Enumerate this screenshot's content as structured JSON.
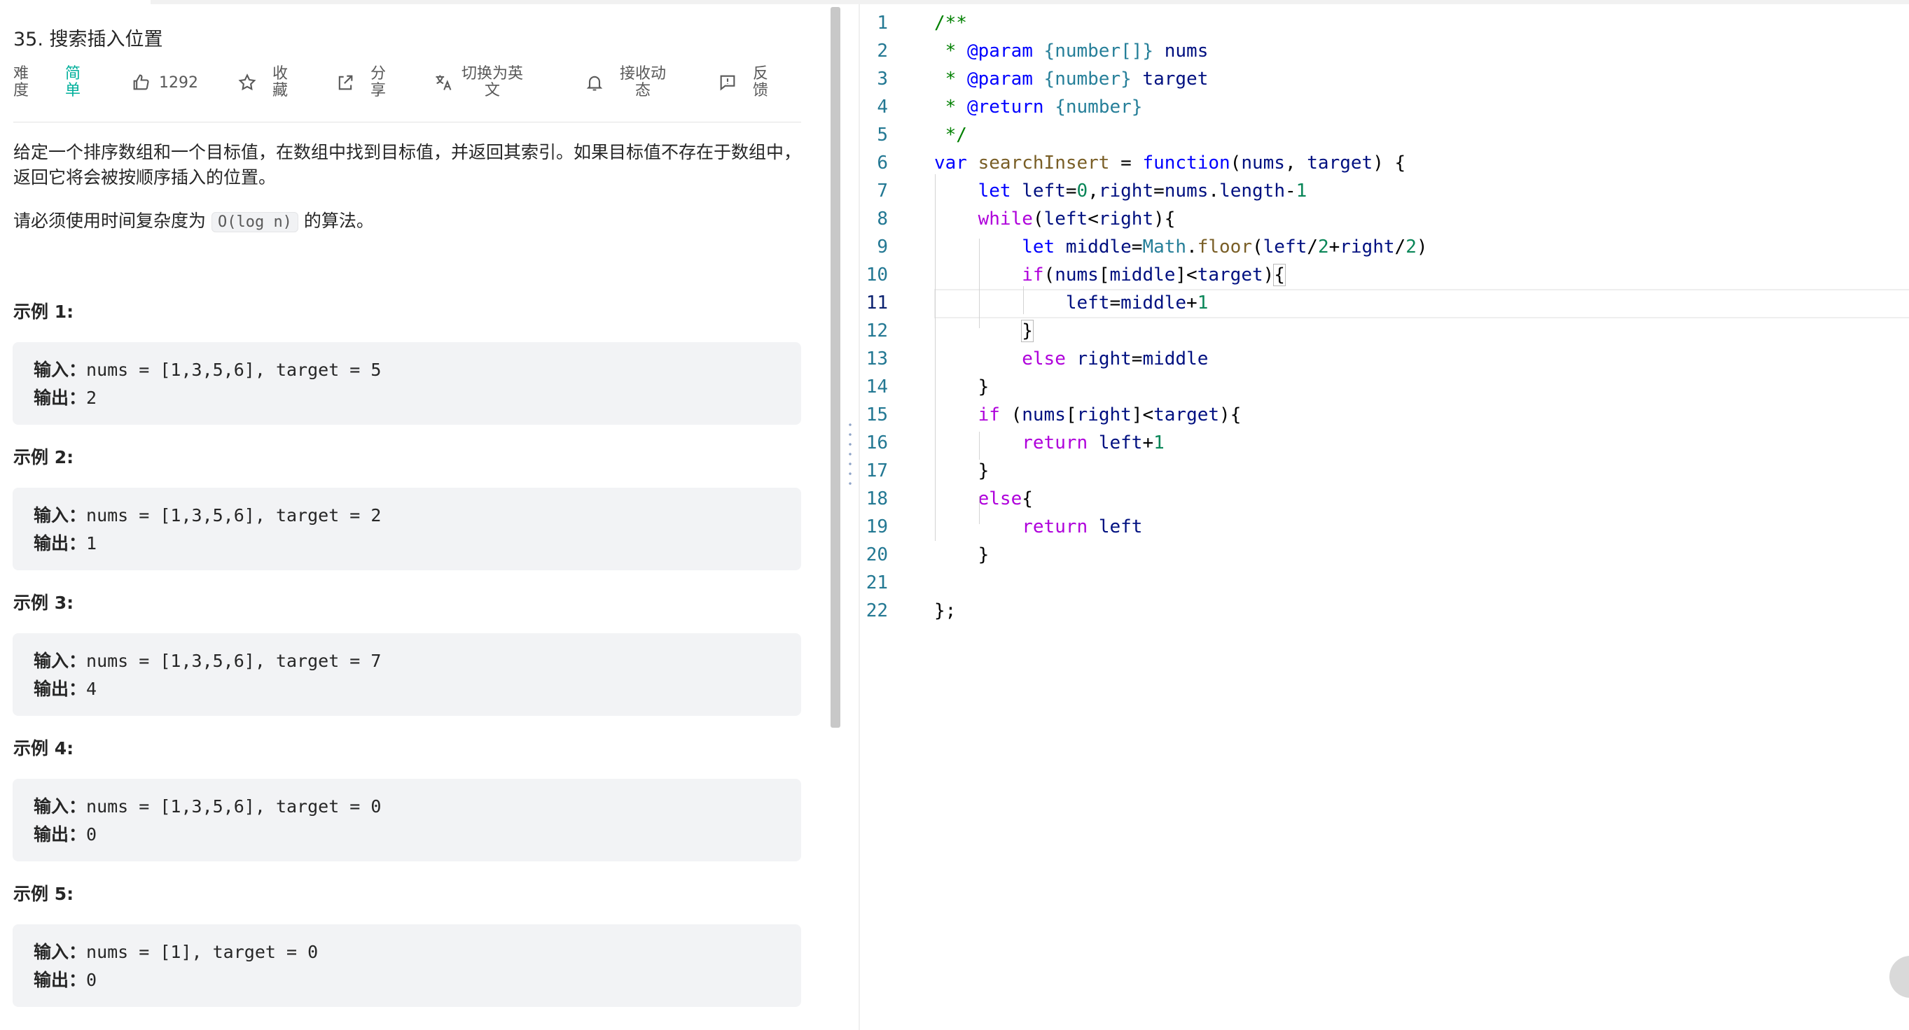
{
  "problem": {
    "title": "35. 搜索插入位置",
    "difficulty_label_top": "难",
    "difficulty_label_bottom": "度",
    "difficulty_value_top": "简",
    "difficulty_value_bottom": "单",
    "likes": "1292",
    "collect_top": "收",
    "collect_bottom": "藏",
    "share_top": "分",
    "share_bottom": "享",
    "translate_top": "切换为英",
    "translate_bottom": "文",
    "subscribe_top": "接收动",
    "subscribe_bottom": "态",
    "feedback_top": "反",
    "feedback_bottom": "馈",
    "description_1": "给定一个排序数组和一个目标值，在数组中找到目标值，并返回其索引。如果目标值不存在于数组中，返回它将会被按顺序插入的位置。",
    "description_2_before": "请必须使用时间复杂度为",
    "description_2_code": "O(log n)",
    "description_2_after": "的算法。",
    "colors": {
      "easy": "#00af9b",
      "accent_gutter": "#237893"
    }
  },
  "examples": [
    {
      "title": "示例 1:",
      "input_label": "输入：",
      "input": "nums = [1,3,5,6], target = 5",
      "output_label": "输出：",
      "output": "2"
    },
    {
      "title": "示例 2:",
      "input_label": "输入：",
      "input": "nums = [1,3,5,6], target = 2",
      "output_label": "输出：",
      "output": "1"
    },
    {
      "title": "示例 3:",
      "input_label": "输入：",
      "input": "nums = [1,3,5,6], target = 7",
      "output_label": "输出：",
      "output": "4"
    },
    {
      "title": "示例 4:",
      "input_label": "输入：",
      "input": "nums = [1,3,5,6], target = 0",
      "output_label": "输出：",
      "output": "0"
    },
    {
      "title": "示例 5:",
      "input_label": "输入：",
      "input": "nums = [1], target = 0",
      "output_label": "输出：",
      "output": "0"
    }
  ],
  "editor": {
    "active_line": 11,
    "line_numbers": [
      "1",
      "2",
      "3",
      "4",
      "5",
      "6",
      "7",
      "8",
      "9",
      "10",
      "11",
      "12",
      "13",
      "14",
      "15",
      "16",
      "17",
      "18",
      "19",
      "20",
      "21",
      "22"
    ],
    "lines": [
      [
        [
          "cm",
          "/**"
        ]
      ],
      [
        [
          "cm",
          " * "
        ],
        [
          "kc2",
          "@param"
        ],
        [
          "ty",
          " {number[]}"
        ],
        [
          "id",
          " nums"
        ]
      ],
      [
        [
          "cm",
          " * "
        ],
        [
          "kc2",
          "@param"
        ],
        [
          "ty",
          " {number}"
        ],
        [
          "id",
          " target"
        ]
      ],
      [
        [
          "cm",
          " * "
        ],
        [
          "kc2",
          "@return"
        ],
        [
          "ty",
          " {number}"
        ]
      ],
      [
        [
          "cm",
          " */"
        ]
      ],
      [
        [
          "k",
          "var"
        ],
        [
          "op",
          " "
        ],
        [
          "fn",
          "searchInsert"
        ],
        [
          "op",
          " = "
        ],
        [
          "k",
          "function"
        ],
        [
          "op",
          "("
        ],
        [
          "id",
          "nums"
        ],
        [
          "op",
          ", "
        ],
        [
          "id",
          "target"
        ],
        [
          "op",
          ") {"
        ]
      ],
      [
        [
          "op",
          "    "
        ],
        [
          "k",
          "let"
        ],
        [
          "op",
          " "
        ],
        [
          "id",
          "left"
        ],
        [
          "op",
          "="
        ],
        [
          "nm",
          "0"
        ],
        [
          "op",
          ","
        ],
        [
          "id",
          "right"
        ],
        [
          "op",
          "="
        ],
        [
          "id",
          "nums"
        ],
        [
          "op",
          "."
        ],
        [
          "id",
          "length"
        ],
        [
          "op",
          "-"
        ],
        [
          "nm",
          "1"
        ]
      ],
      [
        [
          "op",
          "    "
        ],
        [
          "kc",
          "while"
        ],
        [
          "op",
          "("
        ],
        [
          "id",
          "left"
        ],
        [
          "op",
          "<"
        ],
        [
          "id",
          "right"
        ],
        [
          "op",
          "){"
        ]
      ],
      [
        [
          "op",
          "        "
        ],
        [
          "k",
          "let"
        ],
        [
          "op",
          " "
        ],
        [
          "id",
          "middle"
        ],
        [
          "op",
          "="
        ],
        [
          "ty",
          "Math"
        ],
        [
          "op",
          "."
        ],
        [
          "fn",
          "floor"
        ],
        [
          "op",
          "("
        ],
        [
          "id",
          "left"
        ],
        [
          "op",
          "/"
        ],
        [
          "nm",
          "2"
        ],
        [
          "op",
          "+"
        ],
        [
          "id",
          "right"
        ],
        [
          "op",
          "/"
        ],
        [
          "nm",
          "2"
        ],
        [
          "op",
          ")"
        ]
      ],
      [
        [
          "op",
          "        "
        ],
        [
          "kc",
          "if"
        ],
        [
          "op",
          "("
        ],
        [
          "id",
          "nums"
        ],
        [
          "op",
          "["
        ],
        [
          "id",
          "middle"
        ],
        [
          "op",
          "]<"
        ],
        [
          "id",
          "target"
        ],
        [
          "op",
          ")"
        ],
        [
          "bm",
          "{"
        ]
      ],
      [
        [
          "op",
          "            "
        ],
        [
          "id",
          "left"
        ],
        [
          "op",
          "="
        ],
        [
          "id",
          "middle"
        ],
        [
          "op",
          "+"
        ],
        [
          "nm",
          "1"
        ]
      ],
      [
        [
          "op",
          "        "
        ],
        [
          "bm",
          "}"
        ]
      ],
      [
        [
          "op",
          "        "
        ],
        [
          "kc",
          "else"
        ],
        [
          "op",
          " "
        ],
        [
          "id",
          "right"
        ],
        [
          "op",
          "="
        ],
        [
          "id",
          "middle"
        ]
      ],
      [
        [
          "op",
          "    }"
        ]
      ],
      [
        [
          "op",
          "    "
        ],
        [
          "kc",
          "if"
        ],
        [
          "op",
          " ("
        ],
        [
          "id",
          "nums"
        ],
        [
          "op",
          "["
        ],
        [
          "id",
          "right"
        ],
        [
          "op",
          "]<"
        ],
        [
          "id",
          "target"
        ],
        [
          "op",
          "){"
        ]
      ],
      [
        [
          "op",
          "        "
        ],
        [
          "kc",
          "return"
        ],
        [
          "op",
          " "
        ],
        [
          "id",
          "left"
        ],
        [
          "op",
          "+"
        ],
        [
          "nm",
          "1"
        ]
      ],
      [
        [
          "op",
          "    }"
        ]
      ],
      [
        [
          "op",
          "    "
        ],
        [
          "kc",
          "else"
        ],
        [
          "op",
          "{"
        ]
      ],
      [
        [
          "op",
          "        "
        ],
        [
          "kc",
          "return"
        ],
        [
          "op",
          " "
        ],
        [
          "id",
          "left"
        ]
      ],
      [
        [
          "op",
          "    }"
        ]
      ],
      [
        [
          "op",
          ""
        ]
      ],
      [
        [
          "op",
          "};"
        ]
      ]
    ]
  }
}
